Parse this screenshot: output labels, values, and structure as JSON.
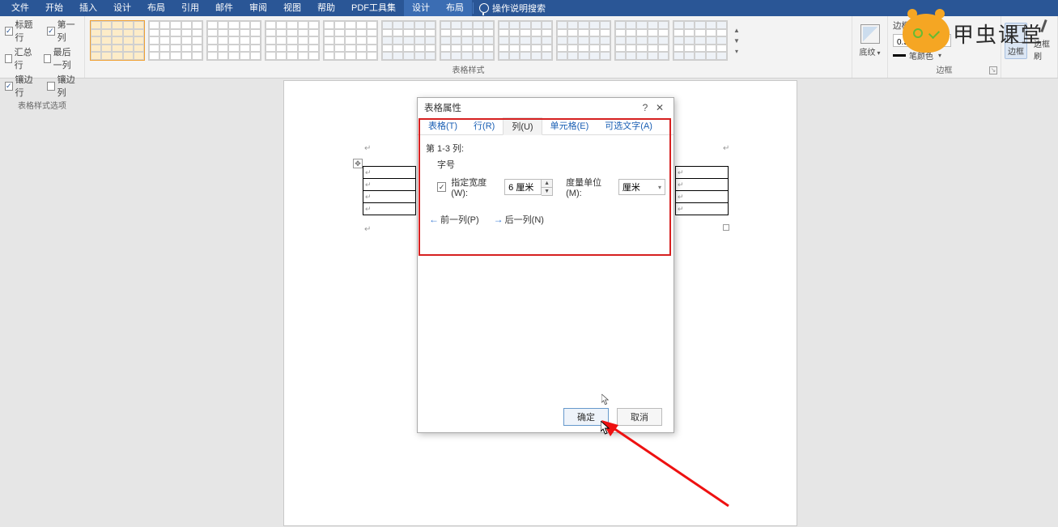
{
  "tabs": {
    "file": "文件",
    "home": "开始",
    "insert": "插入",
    "design": "设计",
    "layout": "布局",
    "refs": "引用",
    "mail": "邮件",
    "review": "审阅",
    "view": "视图",
    "help": "帮助",
    "pdf": "PDF工具集",
    "ctx_design": "设计",
    "ctx_layout": "布局",
    "search": "操作说明搜索"
  },
  "styleOptions": {
    "headerRow": "标题行",
    "firstCol": "第一列",
    "totalRow": "汇总行",
    "lastCol": "最后一列",
    "bandedRow": "镶边行",
    "bandedCol": "镶边列",
    "groupLabel": "表格样式选项"
  },
  "tableStyles": {
    "groupLabel": "表格样式"
  },
  "shading": {
    "label": "底纹"
  },
  "borderStyle": {
    "styleLabel": "边框样式",
    "thickness": "0.5 磅",
    "penColorLabel": "笔颜色"
  },
  "borderBtns": {
    "border": "边框",
    "painter": "边框刷",
    "groupLabel": "边框"
  },
  "logo": "甲虫课堂",
  "dialog": {
    "title": "表格属性",
    "tabs": {
      "table": "表格(T)",
      "row": "行(R)",
      "col": "列(U)",
      "cell": "单元格(E)",
      "alt": "可选文字(A)"
    },
    "colRange": "第 1-3 列:",
    "sizeLabel": "字号",
    "widthLabel": "指定宽度(W):",
    "widthValue": "6 厘米",
    "unitLabel": "度量单位(M):",
    "unitValue": "厘米",
    "prevCol": "前一列(P)",
    "nextCol": "后一列(N)",
    "ok": "确定",
    "cancel": "取消"
  }
}
